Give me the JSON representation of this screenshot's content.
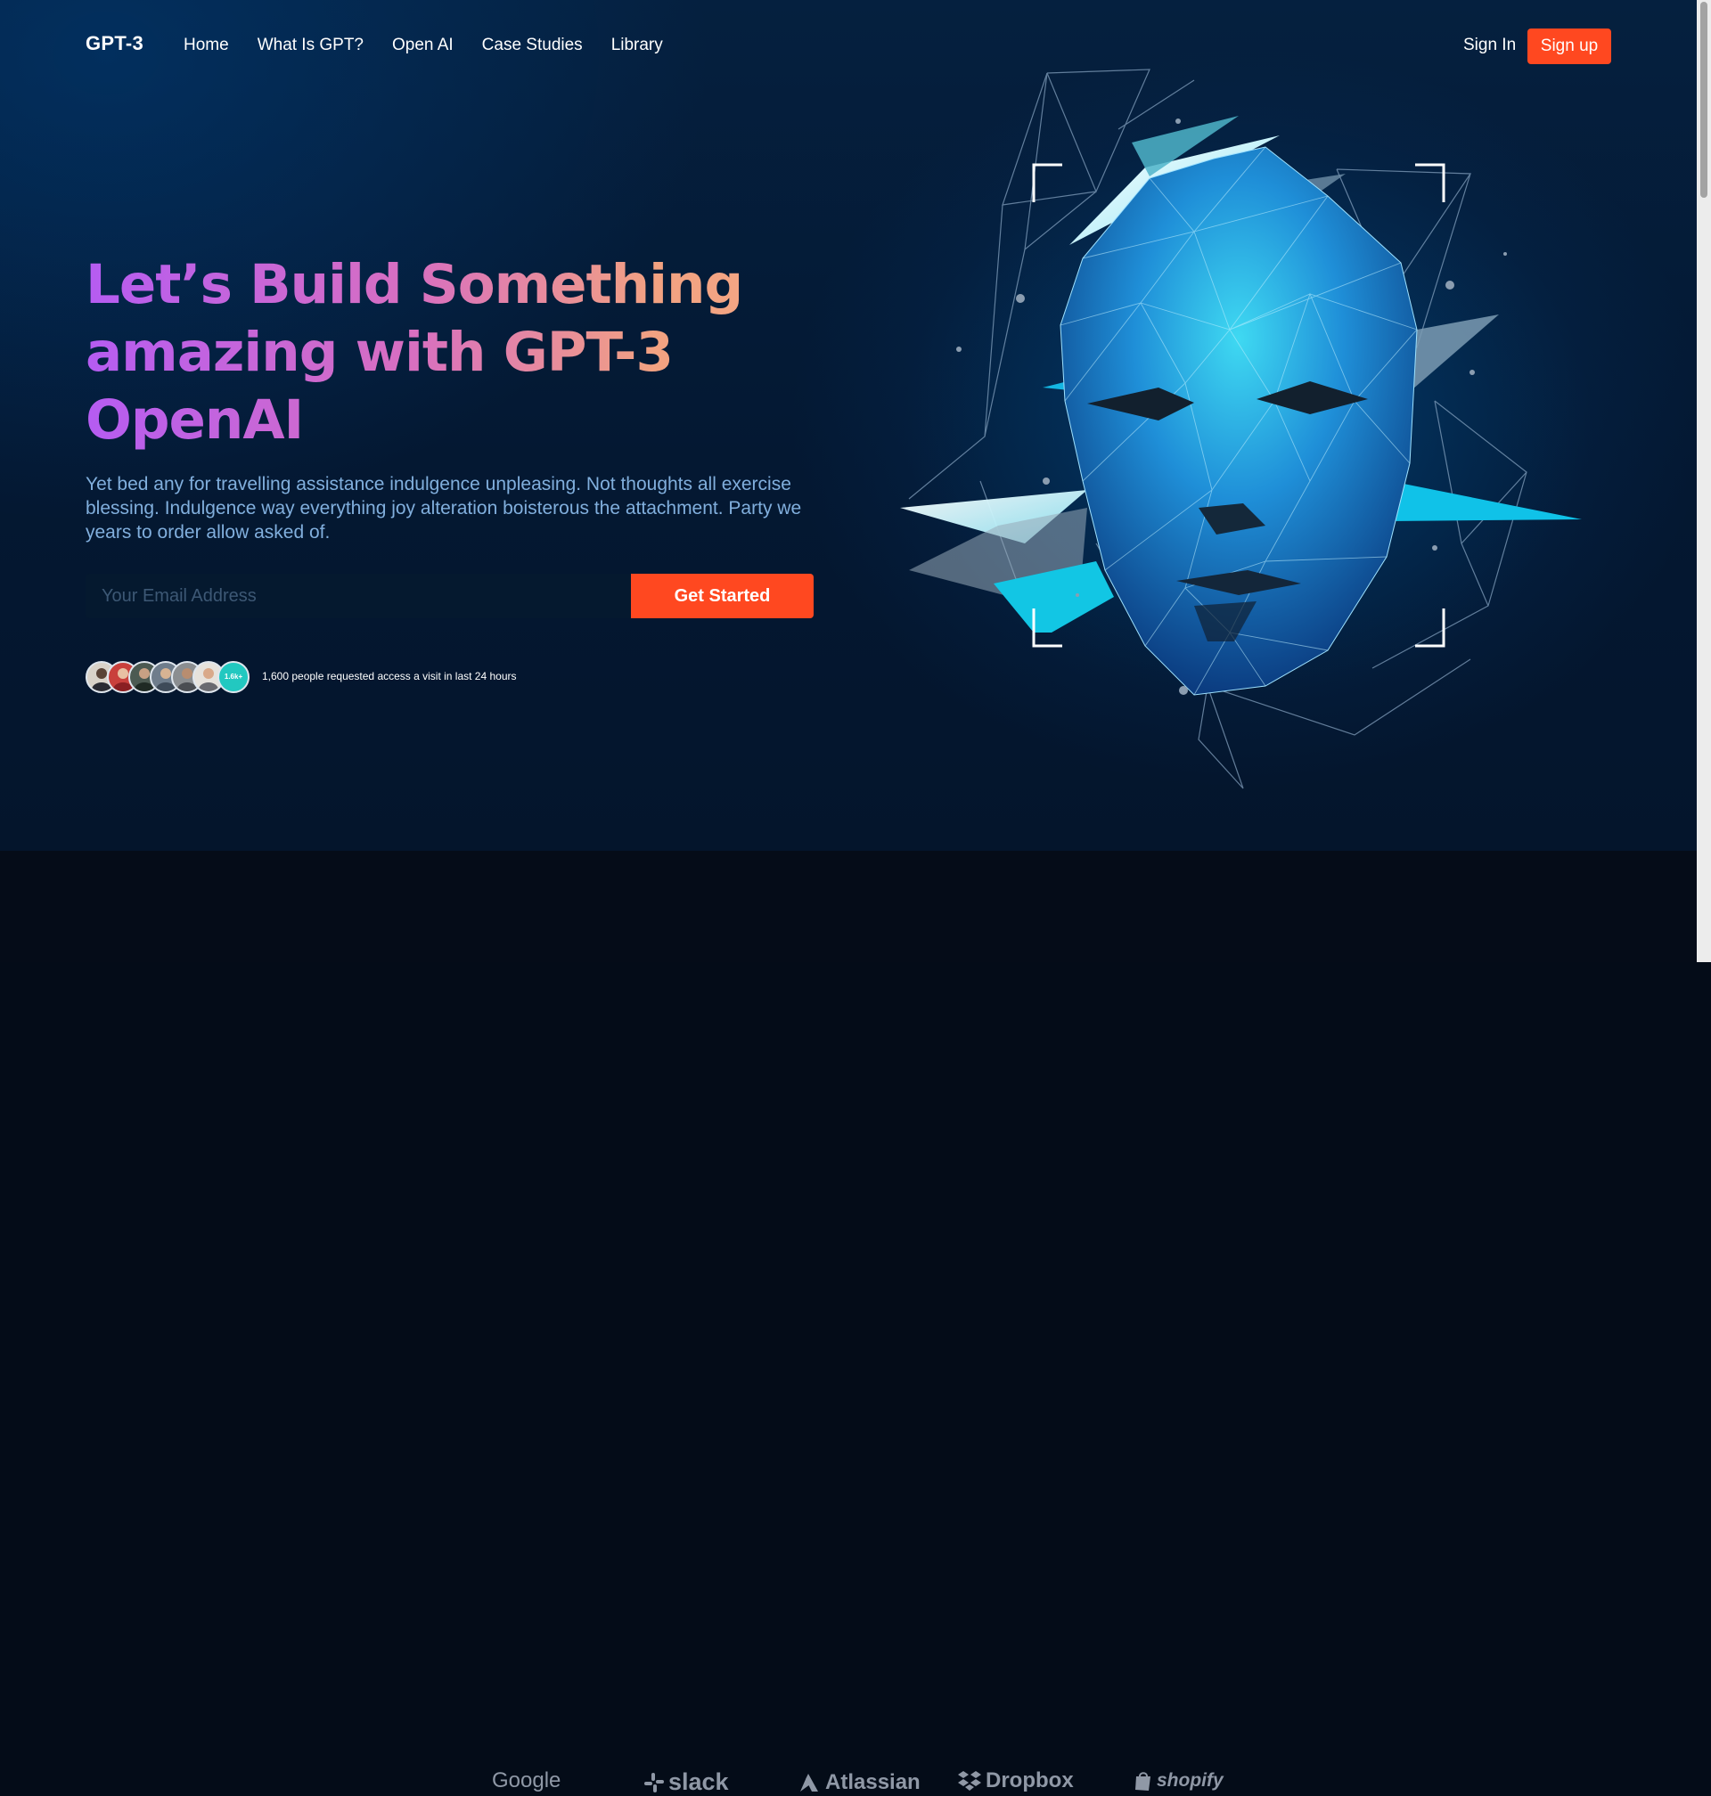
{
  "header": {
    "logo": "GPT-3",
    "nav": [
      {
        "label": "Home"
      },
      {
        "label": "What Is GPT?"
      },
      {
        "label": "Open AI"
      },
      {
        "label": "Case Studies"
      },
      {
        "label": "Library"
      }
    ],
    "sign_in": "Sign In",
    "sign_up": "Sign up"
  },
  "hero": {
    "headline": "Let’s Build Something amazing with GPT-3 OpenAI",
    "description": "Yet bed any for travelling assistance indulgence unpleasing. Not thoughts all exercise blessing. Indulgence way everything joy alteration boisterous the attachment. Party we years to order allow asked of.",
    "email_placeholder": "Your Email Address",
    "cta": "Get Started",
    "avatars_count": "1.6k+",
    "access_text": "1,600 people requested access a visit in last 24 hours"
  },
  "brands": [
    "Google",
    "slack",
    "Atlassian",
    "Dropbox",
    "shopify"
  ],
  "colors": {
    "accent": "#ff4820",
    "headline_gradient_start": "#b55cf2",
    "headline_gradient_end": "#f5a886",
    "description": "#81afdd",
    "count_badge": "#22c8c0"
  }
}
